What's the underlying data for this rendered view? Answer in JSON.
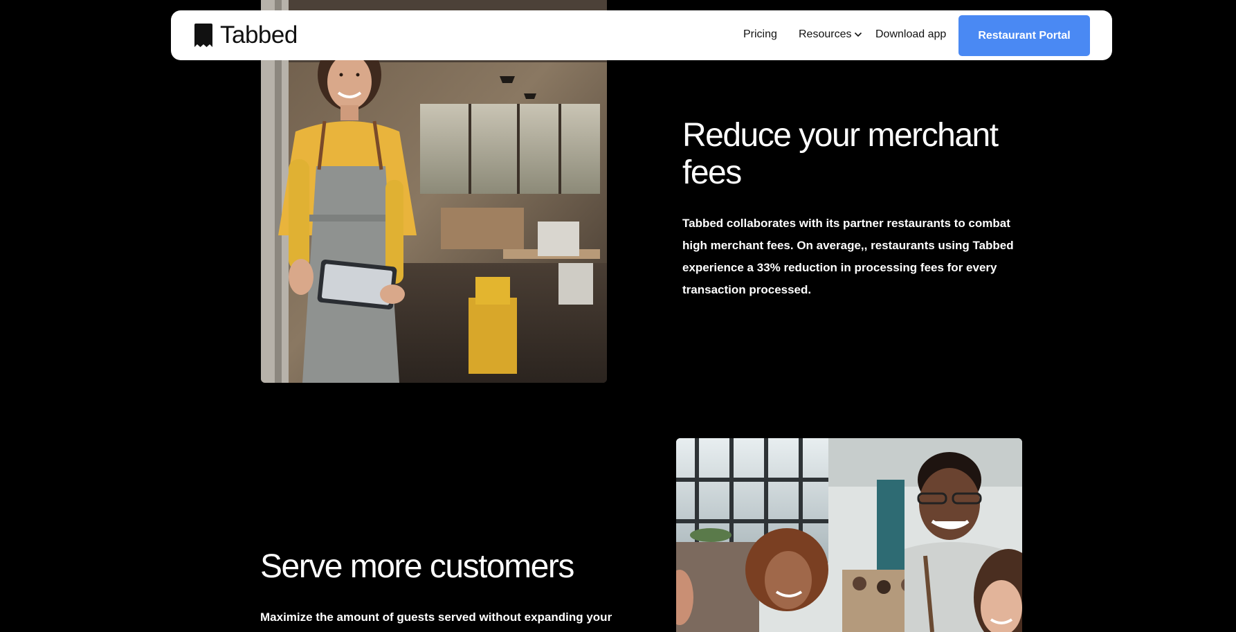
{
  "navbar": {
    "brand": "Tabbed",
    "links": {
      "pricing": "Pricing",
      "resources": "Resources",
      "download": "Download app"
    },
    "cta": "Restaurant Portal"
  },
  "sections": [
    {
      "title": "Reduce your merchant fees",
      "body": "Tabbed collaborates with its partner restaurants to combat high merchant fees. On average,, restaurants using Tabbed experience a 33% reduction in processing fees for every transaction processed."
    },
    {
      "title": "Serve more customers",
      "body": "Maximize the amount of guests served without expanding your"
    }
  ],
  "colors": {
    "background": "#000000",
    "navbar": "#ffffff",
    "accent": "#4a89f3"
  }
}
